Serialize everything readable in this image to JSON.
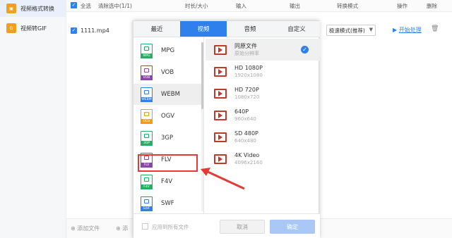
{
  "sidebar": {
    "items": [
      {
        "label": "视频格式转换",
        "icon": "video-convert-icon",
        "active": true
      },
      {
        "label": "视频转GIF",
        "icon": "gif-icon",
        "active": false
      }
    ]
  },
  "header": {
    "select_all": "全选",
    "clear_selected": "清除选中(1/1)",
    "duration_size": "时长/大小",
    "input": "输入",
    "output": "输出",
    "convert_mode": "转换模式",
    "action": "操作",
    "delete": "删除"
  },
  "file": {
    "name": "1111.mp4",
    "mode_value": "极速模式(推荐)",
    "start_label": "开始处理"
  },
  "bottom": {
    "add_file": "添加文件",
    "add_folder_partial": "添"
  },
  "popup": {
    "tabs": [
      "最近",
      "视频",
      "音频",
      "自定义"
    ],
    "active_tab": 1,
    "formats": [
      {
        "label": "MPG",
        "badge": "MPG",
        "color": "#27ae60"
      },
      {
        "label": "VOB",
        "badge": "VOB",
        "color": "#8e44ad"
      },
      {
        "label": "WEBM",
        "badge": "WEBM",
        "color": "#2f80ed"
      },
      {
        "label": "OGV",
        "badge": "OGV",
        "color": "#f39c12"
      },
      {
        "label": "3GP",
        "badge": "3GP",
        "color": "#27ae60"
      },
      {
        "label": "FLV",
        "badge": "FLV",
        "color": "#8e44ad"
      },
      {
        "label": "F4V",
        "badge": "F4V",
        "color": "#27ae60"
      },
      {
        "label": "SWF",
        "badge": "SWF",
        "color": "#2f80ed"
      }
    ],
    "active_format": 2,
    "presets": [
      {
        "name": "同原文件",
        "res": "原始分辨率"
      },
      {
        "name": "HD 1080P",
        "res": "1920x1080"
      },
      {
        "name": "HD 720P",
        "res": "1080x720"
      },
      {
        "name": "640P",
        "res": "960x640"
      },
      {
        "name": "SD 480P",
        "res": "640x480"
      },
      {
        "name": "4K Video",
        "res": "4096x2160"
      }
    ],
    "active_preset": 0,
    "apply_all": "应用到所有文件",
    "cancel": "取消",
    "confirm": "确定"
  },
  "colors": {
    "accent": "#2f80ed",
    "highlight": "#e53935"
  }
}
